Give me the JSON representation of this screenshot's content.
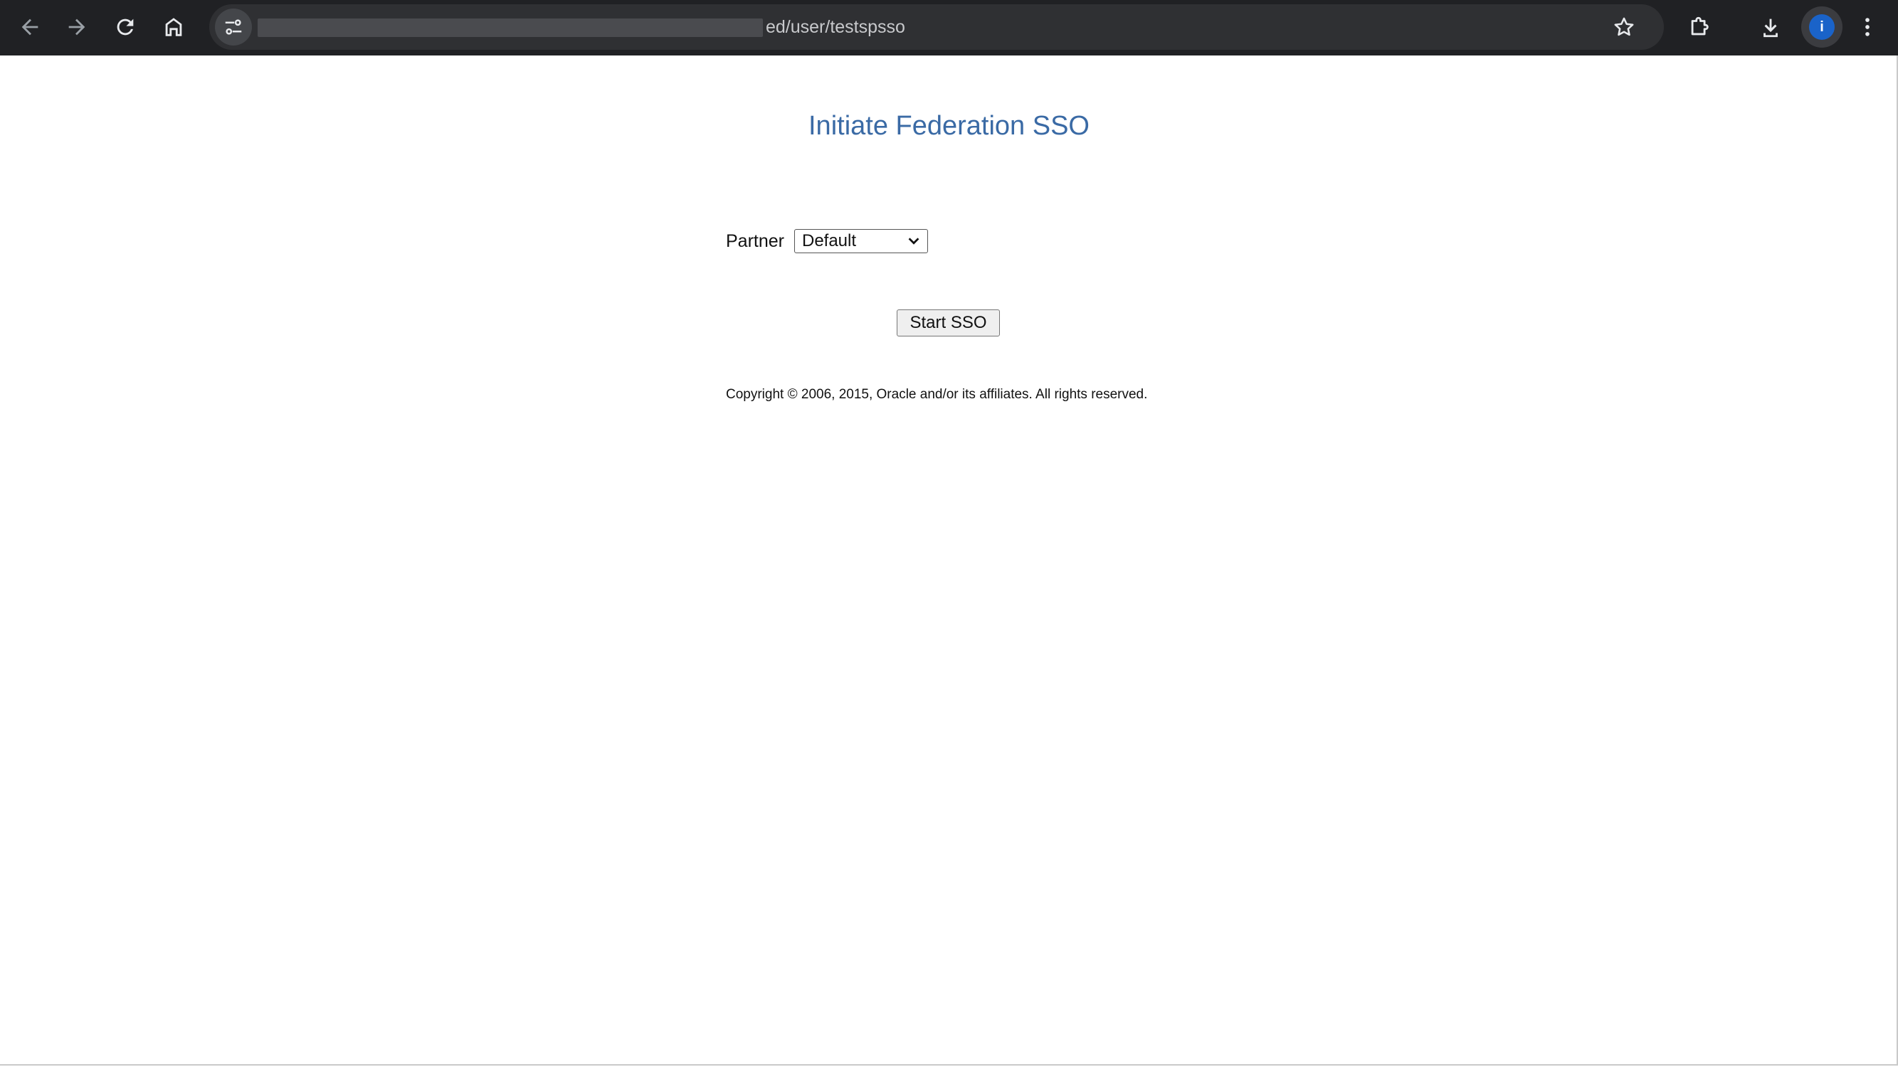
{
  "browser": {
    "url_visible": "ed/user/testspsso",
    "profile_initial": "i"
  },
  "page": {
    "title": "Initiate Federation SSO",
    "partner_label": "Partner",
    "partner_selected": "Default",
    "start_button": "Start SSO",
    "copyright": "Copyright © 2006, 2015, Oracle and/or its affiliates. All rights reserved."
  },
  "colors": {
    "toolbar_bg": "#202124",
    "omnibox_bg": "#2f3033",
    "title_blue": "#3a6aa5",
    "avatar_blue": "#1a63c9"
  }
}
